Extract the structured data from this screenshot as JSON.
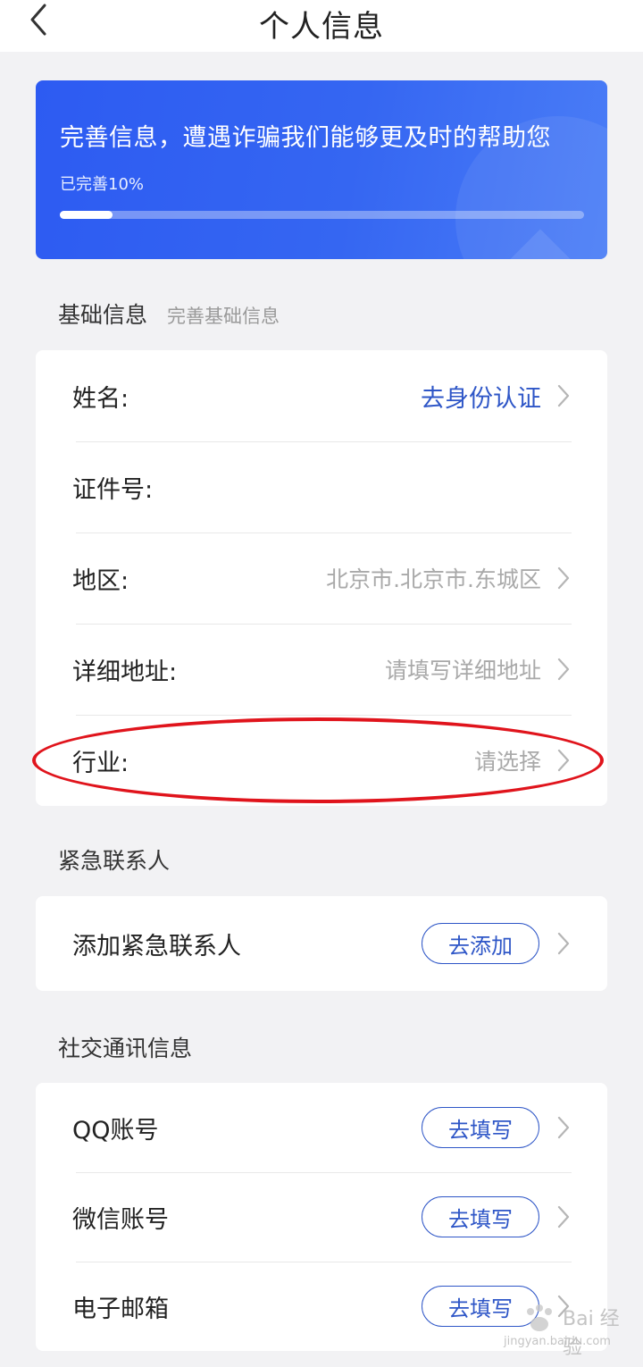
{
  "header": {
    "title": "个人信息",
    "back_icon": "chevron-left-icon"
  },
  "banner": {
    "title": "完善信息，遭遇诈骗我们能够更及时的帮助您",
    "progress_text": "已完善10%",
    "progress_fraction": 0.1,
    "background_color": "#3566f2"
  },
  "basic_info": {
    "section_title": "基础信息",
    "section_hint": "完善基础信息",
    "rows": [
      {
        "label": "姓名:",
        "value": "去身份认证"
      },
      {
        "label": "证件号:",
        "value": ""
      },
      {
        "label": "地区:",
        "value": "北京市.北京市.东城区"
      },
      {
        "label": "详细地址:",
        "value": "请填写详细地址"
      },
      {
        "label": "行业:",
        "value": "请选择"
      }
    ]
  },
  "emergency": {
    "section_title": "紧急联系人",
    "row_label": "添加紧急联系人",
    "button_label": "去添加"
  },
  "social": {
    "section_title": "社交通讯信息",
    "rows": [
      {
        "label": "QQ账号",
        "button_label": "去填写"
      },
      {
        "label": "微信账号",
        "button_label": "去填写"
      },
      {
        "label": "电子邮箱",
        "button_label": "去填写"
      }
    ]
  },
  "watermark": {
    "brand": "Bai 经验",
    "url": "jingyan.baidu.com"
  },
  "colors": {
    "accent": "#2e56c7",
    "annotation": "#e0141c",
    "page_background": "#f2f2f4"
  }
}
